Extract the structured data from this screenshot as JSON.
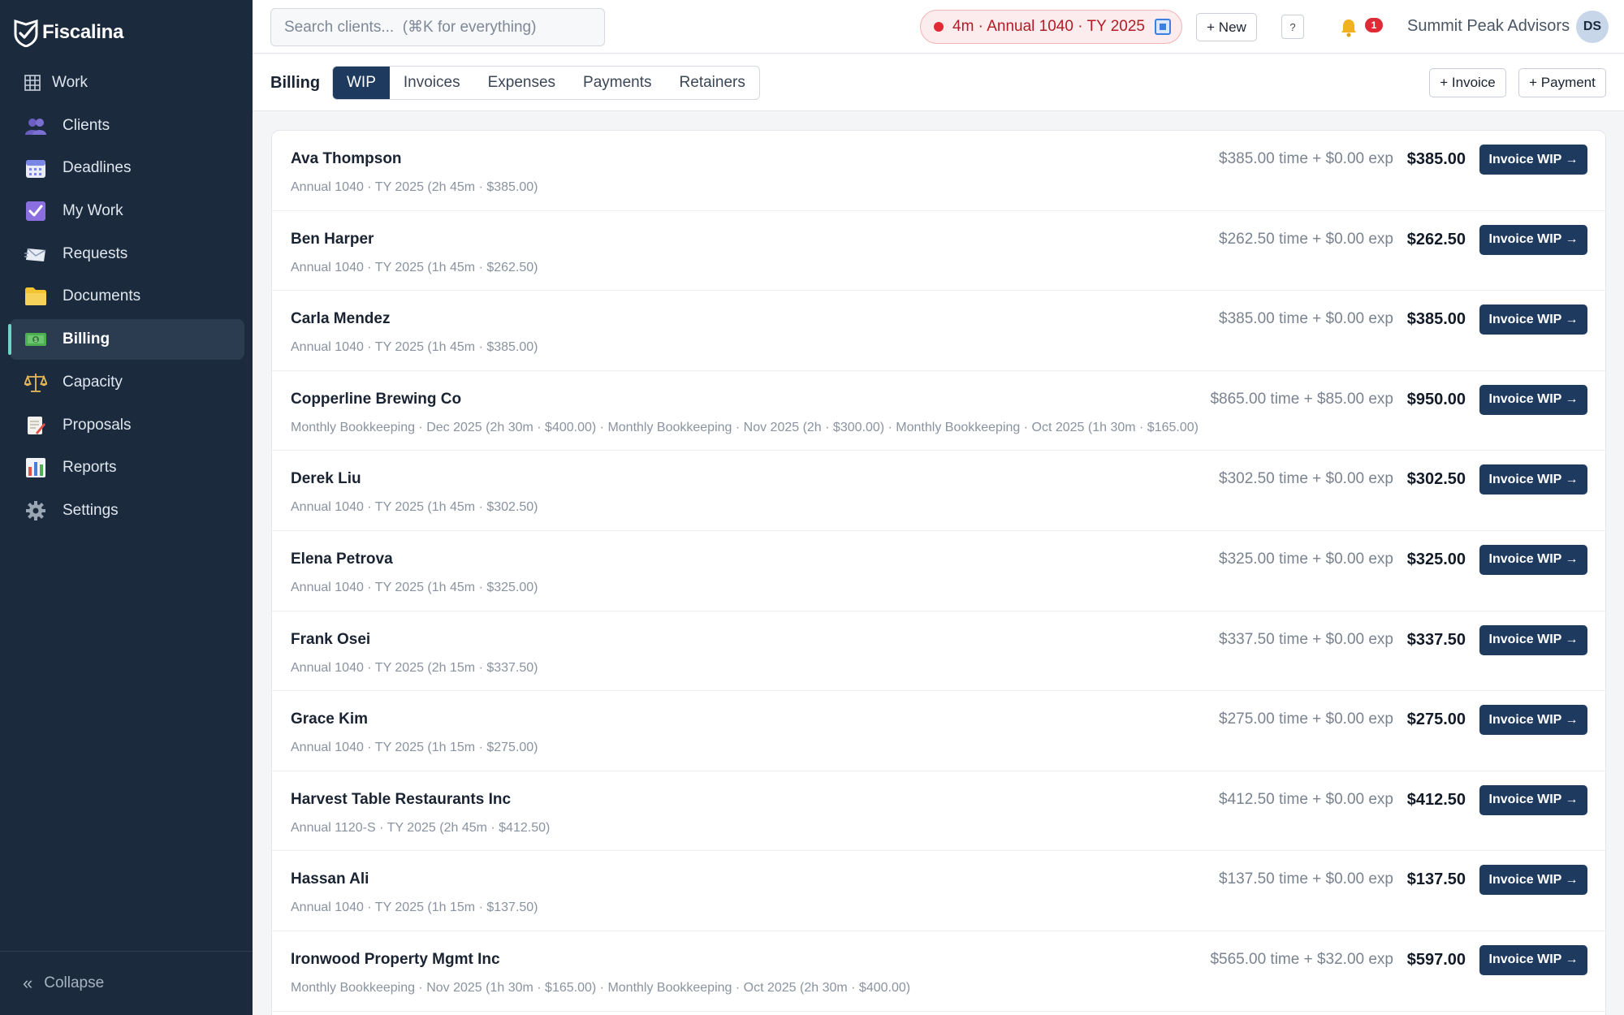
{
  "app": {
    "name": "Fiscalina"
  },
  "sidebar": {
    "items": [
      {
        "label": "Work",
        "icon": "grid-icon"
      },
      {
        "label": "Clients",
        "icon": "people-icon"
      },
      {
        "label": "Deadlines",
        "icon": "calendar-icon"
      },
      {
        "label": "My Work",
        "icon": "checkbox-icon"
      },
      {
        "label": "Requests",
        "icon": "envelope-icon"
      },
      {
        "label": "Documents",
        "icon": "folder-icon"
      },
      {
        "label": "Billing",
        "icon": "money-icon",
        "active": true
      },
      {
        "label": "Capacity",
        "icon": "scales-icon"
      },
      {
        "label": "Proposals",
        "icon": "memo-icon"
      },
      {
        "label": "Reports",
        "icon": "bar-chart-icon"
      },
      {
        "label": "Settings",
        "icon": "gear-icon"
      }
    ],
    "collapse_icon": "«",
    "collapse_label": "Collapse"
  },
  "topbar": {
    "search_placeholder": "Search clients...  (⌘K for everything)",
    "timer_text": "4m · Annual 1040 · TY 2025",
    "new_label": "+ New",
    "help_label": "?",
    "notification_count": "1",
    "org_name": "Summit Peak Advisors",
    "avatar_initials": "DS"
  },
  "subbar": {
    "title": "Billing",
    "tabs": [
      "WIP",
      "Invoices",
      "Expenses",
      "Payments",
      "Retainers"
    ],
    "active_tab": "WIP",
    "invoice_label": "+ Invoice",
    "payment_label": "+ Payment"
  },
  "rows": [
    {
      "name": "Ava Thompson",
      "detail": "Annual 1040 · TY 2025 (2h 45m · $385.00)",
      "breakdown": "$385.00 time + $0.00 exp",
      "total": "$385.00",
      "button": "Invoice WIP →"
    },
    {
      "name": "Ben Harper",
      "detail": "Annual 1040 · TY 2025 (1h 45m · $262.50)",
      "breakdown": "$262.50 time + $0.00 exp",
      "total": "$262.50",
      "button": "Invoice WIP →"
    },
    {
      "name": "Carla Mendez",
      "detail": "Annual 1040 · TY 2025 (1h 45m · $385.00)",
      "breakdown": "$385.00 time + $0.00 exp",
      "total": "$385.00",
      "button": "Invoice WIP →"
    },
    {
      "name": "Copperline Brewing Co",
      "detail": "Monthly Bookkeeping · Dec 2025 (2h 30m · $400.00) · Monthly Bookkeeping · Nov 2025 (2h · $300.00) · Monthly Bookkeeping · Oct 2025 (1h 30m · $165.00)",
      "breakdown": "$865.00 time + $85.00 exp",
      "total": "$950.00",
      "button": "Invoice WIP →"
    },
    {
      "name": "Derek Liu",
      "detail": "Annual 1040 · TY 2025 (1h 45m · $302.50)",
      "breakdown": "$302.50 time + $0.00 exp",
      "total": "$302.50",
      "button": "Invoice WIP →"
    },
    {
      "name": "Elena Petrova",
      "detail": "Annual 1040 · TY 2025 (1h 45m · $325.00)",
      "breakdown": "$325.00 time + $0.00 exp",
      "total": "$325.00",
      "button": "Invoice WIP →"
    },
    {
      "name": "Frank Osei",
      "detail": "Annual 1040 · TY 2025 (2h 15m · $337.50)",
      "breakdown": "$337.50 time + $0.00 exp",
      "total": "$337.50",
      "button": "Invoice WIP →"
    },
    {
      "name": "Grace Kim",
      "detail": "Annual 1040 · TY 2025 (1h 15m · $275.00)",
      "breakdown": "$275.00 time + $0.00 exp",
      "total": "$275.00",
      "button": "Invoice WIP →"
    },
    {
      "name": "Harvest Table Restaurants Inc",
      "detail": "Annual 1120-S · TY 2025 (2h 45m · $412.50)",
      "breakdown": "$412.50 time + $0.00 exp",
      "total": "$412.50",
      "button": "Invoice WIP →"
    },
    {
      "name": "Hassan Ali",
      "detail": "Annual 1040 · TY 2025 (1h 15m · $137.50)",
      "breakdown": "$137.50 time + $0.00 exp",
      "total": "$137.50",
      "button": "Invoice WIP →"
    },
    {
      "name": "Ironwood Property Mgmt Inc",
      "detail": "Monthly Bookkeeping · Nov 2025 (1h 30m · $165.00) · Monthly Bookkeeping · Oct 2025 (2h 30m · $400.00)",
      "breakdown": "$565.00 time + $32.00 exp",
      "total": "$597.00",
      "button": "Invoice WIP →"
    }
  ],
  "colors": {
    "sidebar_bg": "#1b2a3d",
    "primary": "#1e3a5f",
    "active_accent": "#6fd3c5",
    "timer_red": "#e02a35"
  }
}
